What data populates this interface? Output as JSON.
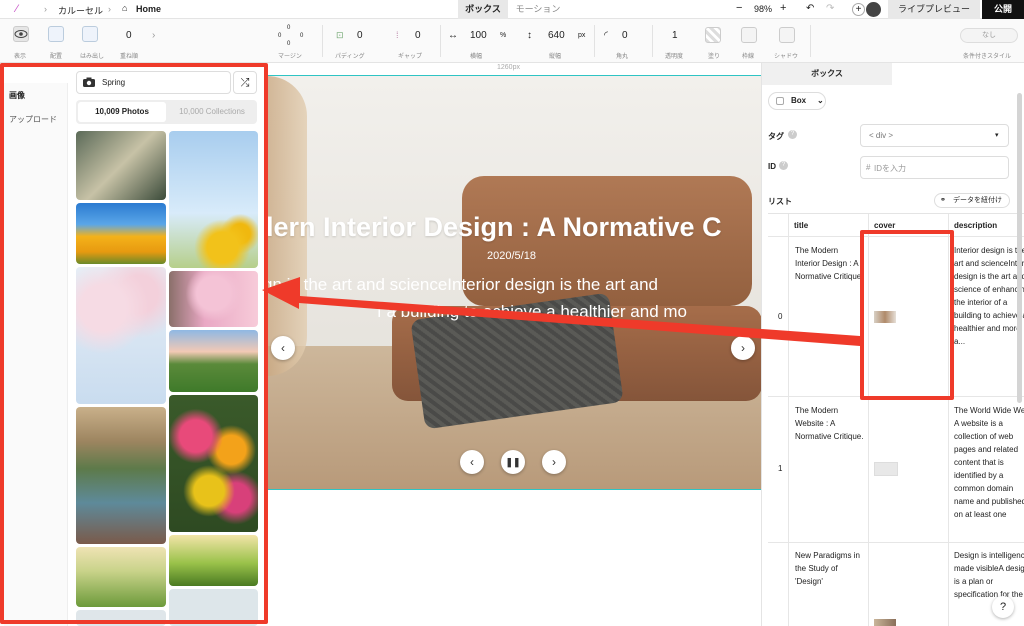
{
  "topbar": {
    "breadcrumb_item": "カルーセル",
    "page": "Home",
    "tabs": [
      "ボックス",
      "モーション"
    ],
    "zoom": "98%",
    "live_preview": "ライブプレビュー",
    "publish": "公開"
  },
  "toolbar": {
    "show": "表示",
    "place": "配置",
    "overflow": "はみ出し",
    "overlap_value": "0",
    "overlap": "重ね順",
    "margin": "マージン",
    "margin_values": [
      "0",
      "0",
      "0",
      "0"
    ],
    "padding": "パディング",
    "padding_value": "0",
    "gap": "ギャップ",
    "gap_value": "0",
    "width_label": "横幅",
    "width_value": "100",
    "width_unit": "%",
    "height_label": "縦幅",
    "height_value": "640",
    "height_unit": "px",
    "radius_label": "角丸",
    "radius_value": "0",
    "opacity_label": "透明度",
    "opacity_value": "1",
    "fill": "塗り",
    "border": "枠線",
    "shadow": "シャドウ",
    "condition_btn": "なし",
    "condition_label": "条件付きスタイル"
  },
  "left_nav": [
    "画像",
    "アップロード"
  ],
  "search": {
    "value": "Spring"
  },
  "segments": {
    "photos": "10,009 Photos",
    "collections": "10,000 Collections"
  },
  "canvas": {
    "width_label": "1260px",
    "slide_title": "dern Interior Design : A Normative C",
    "slide_date": "2020/5/18",
    "slide_line1": "gn is the art and scienceInterior design is the art and",
    "slide_line2": "f a building to achieve a healthier and mo"
  },
  "right": {
    "tab": "ボックス",
    "box_select": "Box",
    "tag_label": "タグ",
    "tag_value": "< div >",
    "id_label": "ID",
    "id_placeholder": "IDを入力",
    "list_label": "リスト",
    "link_data": "データを紐付け",
    "columns": [
      "title",
      "cover",
      "description"
    ],
    "rows": [
      {
        "index": "0",
        "title": "The Modern Interior Design : A Normative Critique.",
        "description": "Interior design is the art and scienceInterior design is the art and science of enhancing the interior of a building to achieve a healthier and more a..."
      },
      {
        "index": "1",
        "title": "The Modern Website : A Normative Critique.",
        "description": "The World Wide Web A website is a collection of web pages and related content that is identified by a common domain name and published on at least one"
      },
      {
        "index": "",
        "title": "New Paradigms in the Study of 'Design'",
        "description": "Design is intelligence made visibleA design is a plan or specification for the"
      }
    ],
    "help": "?"
  },
  "colors": {
    "annotation_red": "#ef3a2a",
    "teal_guide": "#2ec4c4",
    "publish_bg": "#111111"
  }
}
